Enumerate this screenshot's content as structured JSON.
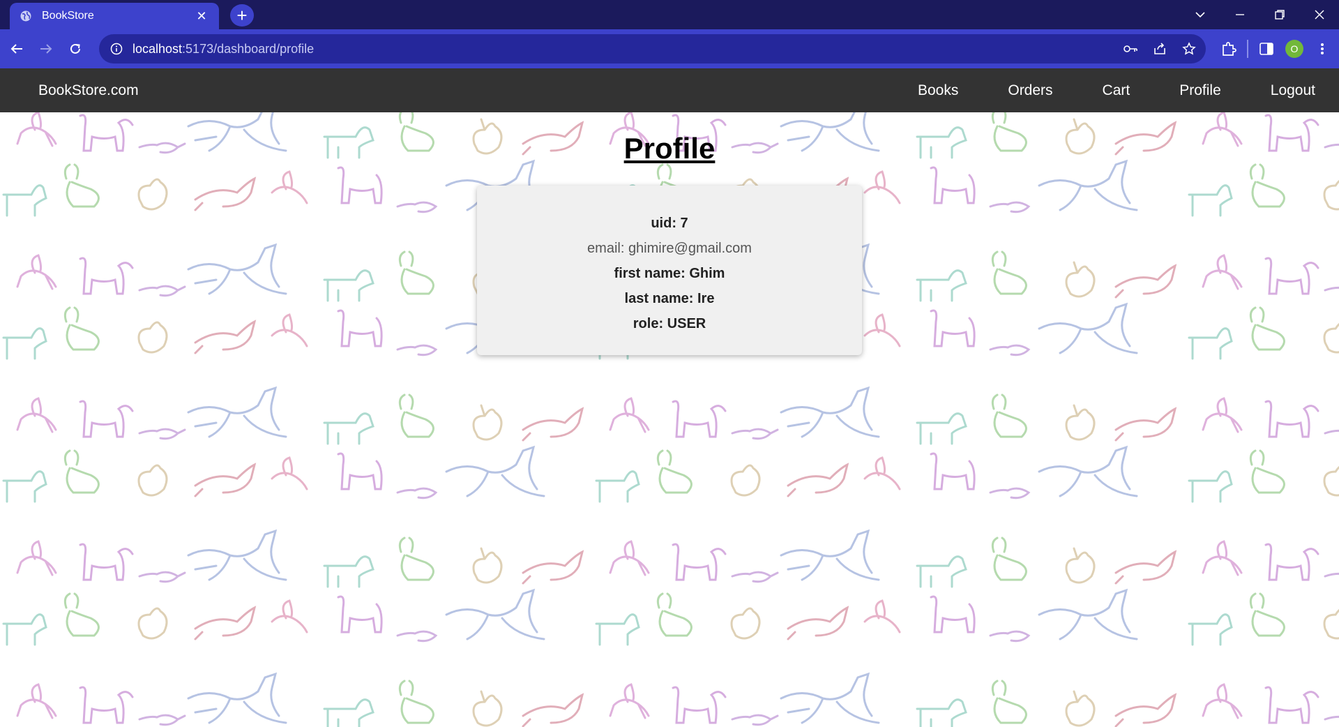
{
  "browser": {
    "tab_title": "BookStore",
    "url_host": "localhost",
    "url_rest": ":5173/dashboard/profile",
    "avatar_letter": "O"
  },
  "nav": {
    "brand": "BookStore.com",
    "links": [
      "Books",
      "Orders",
      "Cart",
      "Profile",
      "Logout"
    ]
  },
  "page": {
    "title": "Profile",
    "profile": {
      "uid": "uid: 7",
      "email": "email: ghimire@gmail.com",
      "first_name": "first name: Ghim",
      "last_name": "last name: Ire",
      "role": "role: USER"
    }
  },
  "colors": {
    "tabbar": "#1b1a5c",
    "toolbar": "#3d42cc",
    "navbar": "#333333",
    "card": "#f0f0f0"
  }
}
